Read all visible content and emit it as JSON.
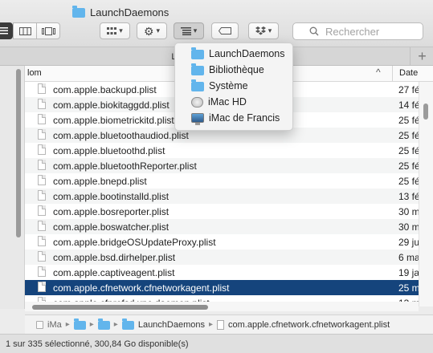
{
  "window": {
    "title": "LaunchDaemons"
  },
  "toolbar": {
    "view_buttons": [
      "list-view",
      "column-view",
      "cover-flow-view"
    ],
    "group_icon": "grid-icon",
    "action_icon": "gear-icon",
    "arrange_icon": "list-arrange-icon",
    "tag_icon": "tag-icon",
    "dropbox_icon": "dropbox-icon",
    "search_placeholder": "Rechercher"
  },
  "tab": {
    "label": "LaunchDaemons",
    "add_label": "+"
  },
  "columns": {
    "name": "Nom",
    "name_visible": "lom",
    "date": "Date",
    "sort_indicator": "^"
  },
  "files": [
    {
      "name": "com.apple.backupd.plist",
      "date": "27 fé"
    },
    {
      "name": "com.apple.biokitaggdd.plist",
      "date": "14 fé"
    },
    {
      "name": "com.apple.biometrickitd.plist",
      "date": "25 fé"
    },
    {
      "name": "com.apple.bluetoothaudiod.plist",
      "date": "25 fé"
    },
    {
      "name": "com.apple.bluetoothd.plist",
      "date": "25 fé"
    },
    {
      "name": "com.apple.bluetoothReporter.plist",
      "date": "25 fé"
    },
    {
      "name": "com.apple.bnepd.plist",
      "date": "25 fé"
    },
    {
      "name": "com.apple.bootinstalld.plist",
      "date": "13 fé"
    },
    {
      "name": "com.apple.bosreporter.plist",
      "date": "30 m"
    },
    {
      "name": "com.apple.boswatcher.plist",
      "date": "30 m"
    },
    {
      "name": "com.apple.bridgeOSUpdateProxy.plist",
      "date": "29 ju"
    },
    {
      "name": "com.apple.bsd.dirhelper.plist",
      "date": "6 ma"
    },
    {
      "name": "com.apple.captiveagent.plist",
      "date": "19 ja"
    },
    {
      "name": "com.apple.cfnetwork.cfnetworkagent.plist",
      "date": "25 m",
      "selected": true
    },
    {
      "name": "com.apple.cfprefsd.xpc.daemon.plist",
      "date": "13 m"
    }
  ],
  "dropdown": {
    "items": [
      {
        "label": "LaunchDaemons",
        "icon": "folder-icon"
      },
      {
        "label": "Bibliothèque",
        "icon": "folder-icon"
      },
      {
        "label": "Système",
        "icon": "folder-icon"
      },
      {
        "label": "iMac HD",
        "icon": "hard-drive-icon"
      },
      {
        "label": "iMac de Francis",
        "icon": "imac-icon"
      }
    ]
  },
  "path": {
    "first": "iMa",
    "current_folder": "LaunchDaemons",
    "file": "com.apple.cfnetwork.cfnetworkagent.plist",
    "separator": "▸"
  },
  "status": {
    "text": "1 sur 335 sélectionné, 300,84 Go disponible(s)"
  },
  "colors": {
    "selection": "#15447c",
    "folder": "#62b5ec"
  }
}
